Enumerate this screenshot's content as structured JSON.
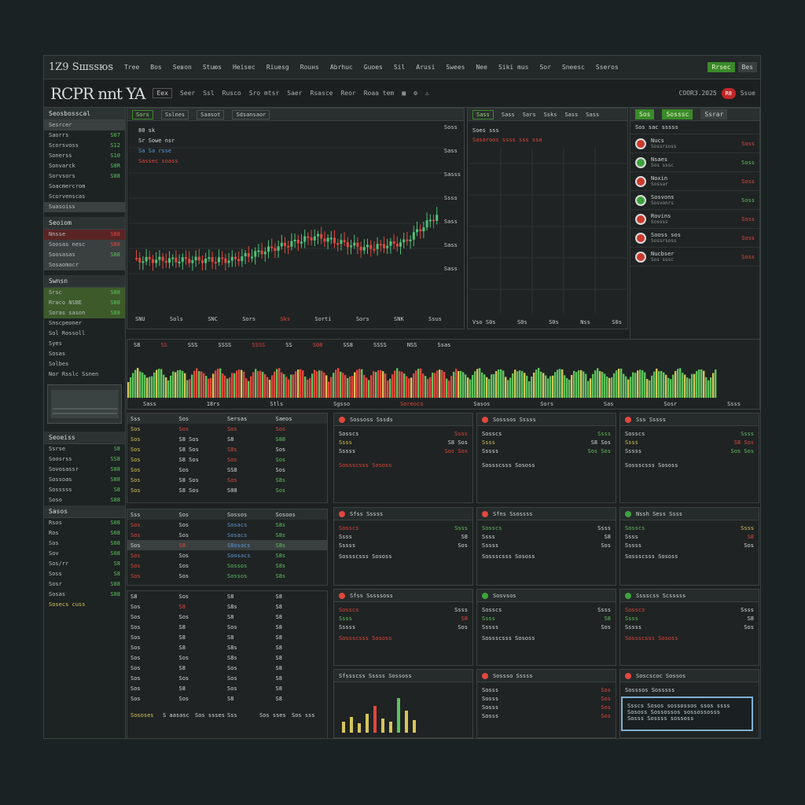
{
  "menubar": {
    "logo": "1Z9 Sшssюs",
    "items": [
      "Tree",
      "Bos",
      "Seвon",
      "Stuюs",
      "Heisec",
      "Riuesg",
      "Rouнs",
      "Abrhuc",
      "Guoes",
      "Sil",
      "Arusi",
      "Swees",
      "Nee",
      "Siki mus",
      "Sor",
      "Sneesc",
      "Sseros",
      "Resosec"
    ],
    "badge_green": "Rrsec",
    "badge_gray": "Bes"
  },
  "toolbar": {
    "brand": "RCPR nnt YA",
    "items": [
      "Eex",
      "Seer",
      "Ssl",
      "Rusco",
      "Sro mtsr",
      "Saer",
      "Rsasce",
      "Reor",
      "Roaa tem"
    ],
    "timestamp": "COOR3.2025",
    "red_badge": "R8",
    "right_label": "Ssue"
  },
  "sidebar": {
    "head1": "Seosbosscal",
    "rows1": [
      {
        "l": "Sesrcer",
        "v": ""
      },
      {
        "l": "Saorrs",
        "v": "S07"
      },
      {
        "l": "Scorsvoss",
        "v": "S12"
      },
      {
        "l": "Sonerss",
        "v": "S10"
      },
      {
        "l": "Sonvarck",
        "v": "S8R"
      },
      {
        "l": "Sorvsors",
        "v": "S88"
      },
      {
        "l": "Soacmercrom",
        "v": ""
      },
      {
        "l": "Scorvenscas",
        "v": ""
      }
    ],
    "sub1": "Suasoiss",
    "head2": "Seoiom",
    "rows2": [
      {
        "l": "Nnsse",
        "v": "S88"
      },
      {
        "l": "Soosas nesc",
        "v": "S88"
      },
      {
        "l": "Soosasas",
        "v": "S88"
      },
      {
        "l": "Sosaomocr",
        "v": ""
      }
    ],
    "head3": "Swnsn",
    "rows3": [
      {
        "l": "Srsc",
        "v": "S88"
      },
      {
        "l": "Rraco NSBE",
        "v": "S88"
      },
      {
        "l": "Soras sason",
        "v": "S88"
      }
    ],
    "rows4": [
      "Snscpeoner",
      "Sol Rossoll",
      "Syes",
      "Sosas",
      "Solbes",
      "Nor Rsslc Ssnen"
    ],
    "head4": "Seoeiss",
    "rows5": [
      {
        "l": "Ssrse",
        "v": "S8"
      },
      {
        "l": "Soosrss",
        "v": "SS8"
      },
      {
        "l": "Sovosassr",
        "v": "S88"
      },
      {
        "l": "Sossoas",
        "v": "S88"
      },
      {
        "l": "Sosssss",
        "v": "S8"
      },
      {
        "l": "Soso",
        "v": "S88"
      }
    ],
    "head5": "Sasos",
    "rows6": [
      {
        "l": "Rsos",
        "v": "S08"
      },
      {
        "l": "Ros",
        "v": "S08"
      },
      {
        "l": "Sos",
        "v": "S08"
      },
      {
        "l": "Sov",
        "v": "S08"
      },
      {
        "l": "Sos/rr",
        "v": "S8"
      },
      {
        "l": "Soss",
        "v": "S8"
      },
      {
        "l": "Sosr",
        "v": "S88"
      },
      {
        "l": "Sosas",
        "v": "S88"
      }
    ],
    "footer": "Sosecs cuss"
  },
  "main_chart": {
    "tabs": [
      "Sors",
      "Sslnes",
      "Saasot",
      "Sdsansaor"
    ],
    "legend": [
      "80 sk",
      "Sr Sowe nsr",
      "Sa Sa rsse",
      "Sassec soass"
    ],
    "price_labels": [
      "Soss",
      "Sass",
      "Sasss",
      "Ssss",
      "Sass",
      "Sass",
      "Sass"
    ],
    "time_labels": [
      "SNU",
      "Sols",
      "SNC",
      "Sors",
      "Sks",
      "Sorti",
      "Sors",
      "SNK",
      "Ssus"
    ]
  },
  "side_chart": {
    "tabs": [
      "Sass",
      "Sass",
      "Sars",
      "Ssks",
      "Sass",
      "Sass"
    ],
    "legend": [
      "Soes sss",
      "Sasaroos ssss sss ssa"
    ],
    "time_labels": [
      "Vso S0s",
      "S0s",
      "S0s",
      "Nss",
      "S0s"
    ]
  },
  "right_panel": {
    "buttons": [
      "Sos",
      "Sosssc",
      "Ssrar"
    ],
    "head_row": "Sos sac sssss",
    "items": [
      {
        "t": "Nucs",
        "s": "Sossrsoss",
        "v": "Soss",
        "g": false
      },
      {
        "t": "Nsaes",
        "s": "Sos sssc",
        "v": "Soss",
        "g": true
      },
      {
        "t": "Noxin",
        "s": "Sossar",
        "v": "Soss",
        "g": false
      },
      {
        "t": "Sosvons",
        "s": "Sosvonrs",
        "v": "Soss",
        "g": true
      },
      {
        "t": "Rovins",
        "s": "Sososs",
        "v": "Soss",
        "g": false
      },
      {
        "t": "Sooss sos",
        "s": "Sossrsoss",
        "v": "Soss",
        "g": false
      },
      {
        "t": "Nucbser",
        "s": "Sos sssc",
        "v": "Soss",
        "g": false
      }
    ]
  },
  "volume": {
    "labels": [
      "S8",
      "SS",
      "SSS",
      "SSSS",
      "SSSS",
      "SS",
      "S08",
      "SS8",
      "SSSS",
      "NSS",
      "Ssas"
    ],
    "axis": [
      "Sass",
      "18rs",
      "Stls",
      "Sgsso",
      "Soreocs",
      "Sasos",
      "Sors",
      "Sas",
      "Sosr",
      "Ssss"
    ]
  },
  "tables": {
    "header": [
      "Sss",
      "Sos",
      "Sersas",
      "Saeos"
    ],
    "rows": [
      [
        "Sos",
        "Sos",
        "Sos",
        "Sos"
      ],
      [
        "Sos",
        "S8 Sos",
        "S8",
        "S88"
      ],
      [
        "Sos",
        "S8 Sos",
        "S8s",
        "Sos"
      ],
      [
        "Sos",
        "S8 Sos",
        "Sos",
        "Sos"
      ],
      [
        "Sos",
        "Sos",
        "SS8",
        "Sos"
      ],
      [
        "Sos",
        "S8 Sos",
        "Sos",
        "S8s"
      ],
      [
        "Sos",
        "S8 Sos",
        "S08",
        "Sos"
      ]
    ],
    "header2": [
      "Sss",
      "Sos",
      "Sossos",
      "Sosoos"
    ],
    "rows2": [
      [
        "Sos",
        "Sos",
        "Sosacs",
        "S8s"
      ],
      [
        "Sos",
        "Sos",
        "Sosacs",
        "S8s"
      ],
      [
        "Sos",
        "S8",
        "S8osacs",
        "S8s"
      ],
      [
        "Sos",
        "Sos",
        "Soosacs",
        "S8s"
      ],
      [
        "Sos",
        "Sos",
        "Sossos",
        "S8s"
      ],
      [
        "Sos",
        "Sos",
        "Sossos",
        "S8s"
      ]
    ],
    "rows3": [
      [
        "S8",
        "Sos",
        "S8",
        "S8"
      ],
      [
        "Sos",
        "S8",
        "S8s",
        "S8"
      ],
      [
        "Sos",
        "Sos",
        "S8",
        "S8"
      ],
      [
        "Sos",
        "S8",
        "Sos",
        "S8"
      ],
      [
        "Sos",
        "S8",
        "S8",
        "S8"
      ],
      [
        "Sos",
        "S8",
        "S8s",
        "S8"
      ],
      [
        "Sos",
        "Sos",
        "S8s",
        "S8"
      ],
      [
        "Sos",
        "S8",
        "Sos",
        "S8"
      ],
      [
        "Sos",
        "Sos",
        "Sos",
        "S8"
      ],
      [
        "Sos",
        "S8",
        "Sos",
        "S8"
      ],
      [
        "Sos",
        "Sos",
        "S8",
        "S8"
      ]
    ],
    "footer": [
      "Sososes",
      "S aasasc",
      "Sos ssses",
      "Sss",
      "Sos sses",
      "Sos sss"
    ]
  },
  "cards": [
    {
      "title": "Sossoss Sssds",
      "lines": [
        [
          "Sosscs",
          "Ssss"
        ],
        [
          "Ssss",
          "S8 Sos"
        ],
        [
          "Sssss",
          "Sos Sos"
        ]
      ],
      "foot": "Sossscsss Sososs"
    },
    {
      "title": "Sosssos Sssss",
      "lines": [
        [
          "Sosscs",
          "Ssss"
        ],
        [
          "Ssss",
          "S8 Sos"
        ],
        [
          "Sssss",
          "Sos Sos"
        ]
      ],
      "foot": "Sossscsss Sososs"
    },
    {
      "title": "Sss Sssss",
      "lines": [
        [
          "Sosscs",
          "Ssss"
        ],
        [
          "Ssss",
          "S8 Sos"
        ],
        [
          "Sssss",
          "Sos Sos"
        ]
      ],
      "foot": "Sossscsss Sososs"
    },
    {
      "title": "Sfss Sssss",
      "lines": [
        [
          "Sosscs",
          "Ssss"
        ],
        [
          "Ssss",
          "S8"
        ],
        [
          "Sssss",
          "Sos"
        ]
      ],
      "foot": "Sossscsss Sososs"
    },
    {
      "title": "Sfns Ssossss",
      "lines": [
        [
          "Sosscs",
          "Ssss"
        ],
        [
          "Ssss",
          "S8"
        ],
        [
          "Sssss",
          "Sos"
        ]
      ],
      "foot": "Sossscsss Sososs"
    },
    {
      "title": "Nssh Sess Ssss",
      "lines": [
        [
          "Sosscs",
          "Ssss"
        ],
        [
          "Ssss",
          "S8"
        ],
        [
          "Sssss",
          "Sos"
        ]
      ],
      "foot": "Sossscsss Sososs"
    },
    {
      "title": "Sfss Sssssoss",
      "lines": [
        [
          "Sosscs",
          "Ssss"
        ],
        [
          "Ssss",
          "S8"
        ],
        [
          "Sssss",
          "Sos"
        ]
      ],
      "foot": "Sossscsss Sososs"
    },
    {
      "title": "Sosvsos",
      "lines": [
        [
          "Sosscs",
          "Ssss"
        ],
        [
          "Ssss",
          "S8"
        ],
        [
          "Sssss",
          "Sos"
        ]
      ],
      "foot": "Sossscsss Sososs"
    },
    {
      "title": "Sssscss Scsssss",
      "lines": [
        [
          "Sosscs",
          "Ssss"
        ],
        [
          "Ssss",
          "S8"
        ],
        [
          "Sssss",
          "Sos"
        ]
      ],
      "foot": "Sossscsss Sososs"
    }
  ],
  "bottom": {
    "mini_title": "Sfssscss Sssss Sossoss",
    "list_title": "Sossso Sssss",
    "list": [
      [
        "Sosss",
        "Sos"
      ],
      [
        "Sosss",
        "Sos"
      ],
      [
        "Sosss",
        "Sos"
      ],
      [
        "Sosss",
        "Sos"
      ]
    ],
    "final_title": "Soscscoc Sossos",
    "final_sub": "Sosssos Sosssss",
    "highlight": [
      "Ssscs Sosos sossossos ssos ssss",
      "Sososs Sossossos sossossosss",
      "Sosss Sossss sossoss"
    ]
  }
}
